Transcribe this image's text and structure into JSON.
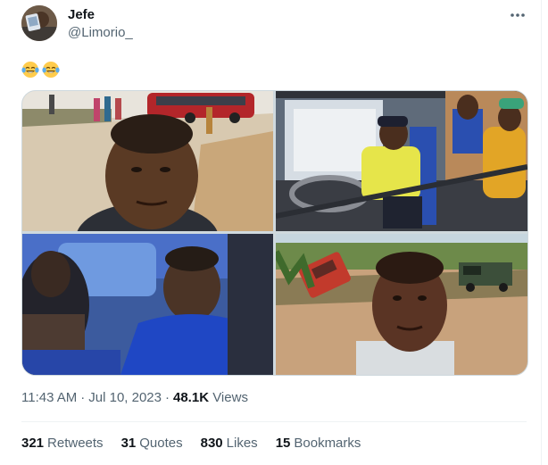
{
  "author": {
    "display_name": "Jefe",
    "handle": "@Limorio_"
  },
  "tweet": {
    "emojis": [
      "face-with-tears-of-joy",
      "face-with-tears-of-joy"
    ],
    "posted_time": "11:43 AM",
    "separator": "·",
    "posted_date": "Jul 10, 2023",
    "views_count": "48.1K",
    "views_label": "Views"
  },
  "media": {
    "photos": [
      {
        "subject": "selfie-man-roadside-red-bus"
      },
      {
        "subject": "man-driving-bus-passengers"
      },
      {
        "subject": "bus-passengers-blue-shirt"
      },
      {
        "subject": "selfie-woman-overturned-red-bus"
      }
    ]
  },
  "stats": [
    {
      "count": "321",
      "label": "Retweets"
    },
    {
      "count": "31",
      "label": "Quotes"
    },
    {
      "count": "830",
      "label": "Likes"
    },
    {
      "count": "15",
      "label": "Bookmarks"
    }
  ],
  "colors": {
    "text_primary": "#0f1419",
    "text_secondary": "#536471",
    "border": "#cfd9de",
    "divider": "#eff3f4"
  }
}
